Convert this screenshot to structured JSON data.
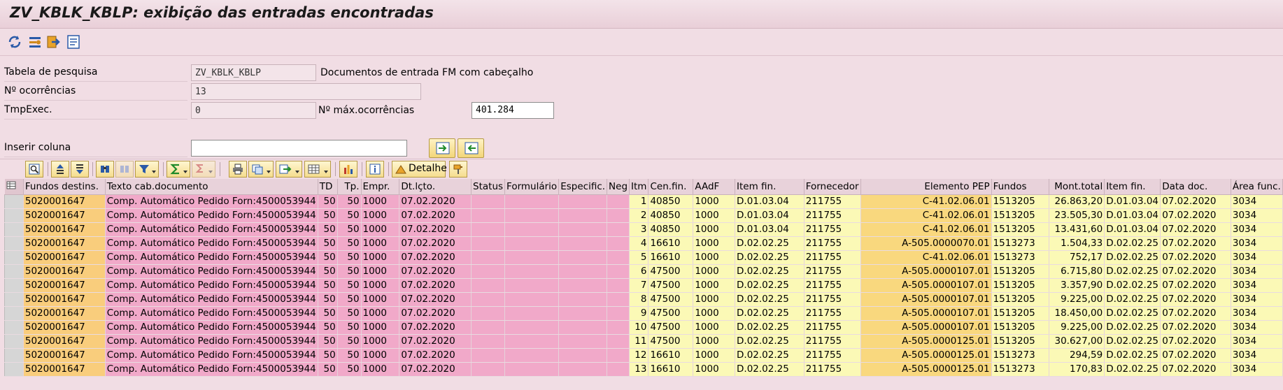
{
  "window": {
    "title": "ZV_KBLK_KBLP: exibição das entradas encontradas"
  },
  "app_toolbar": {
    "icons": [
      "refresh-icon",
      "selection-options-icon",
      "jump-icon",
      "list-icon"
    ]
  },
  "header": {
    "table_label": "Tabela de pesquisa",
    "table_value": "ZV_KBLK_KBLP",
    "table_description": "Documentos de entrada FM com cabeçalho",
    "hits_label": "Nº ocorrências",
    "hits_value": "13",
    "runtime_label": "TmpExec.",
    "runtime_value": "0",
    "max_hits_label": "Nº máx.ocorrências",
    "max_hits_value": "401.284",
    "insert_column_label": "Inserir coluna",
    "insert_column_value": ""
  },
  "grid_toolbar": {
    "detail_label": "Detalhe",
    "icons": [
      "details-icon",
      "sort-ascending-icon",
      "sort-descending-icon",
      "find-icon",
      "find-next-icon",
      "filter-icon",
      "sum-icon",
      "subtotal-icon",
      "print-icon",
      "views-icon",
      "export-icon",
      "layout-icon",
      "graphic-icon",
      "info-icon",
      "detail-icon",
      "paint-icon"
    ]
  },
  "table": {
    "columns": [
      "Fundos destins.",
      "Texto cab.documento",
      "TD",
      "Tp.",
      "Empr.",
      "Dt.lçto.",
      "Status",
      "Formulário",
      "Especific.",
      "Neg",
      "Itm",
      "Cen.fin.",
      "AAdF",
      "Item fin.",
      "Fornecedor",
      "Elemento PEP",
      "Fundos",
      "Mont.total",
      "Item fin.",
      "Data doc.",
      "Área func."
    ],
    "rows": [
      [
        "5020001647",
        "Comp. Automático Pedido Forn:4500053944",
        "50",
        "50",
        "1000",
        "07.02.2020",
        "",
        "",
        "",
        "",
        "1",
        "40850",
        "1000",
        "D.01.03.04",
        "211755",
        "C-41.02.06.01",
        "1513205",
        "26.863,20",
        "D.01.03.04",
        "07.02.2020",
        "3034"
      ],
      [
        "5020001647",
        "Comp. Automático Pedido Forn:4500053944",
        "50",
        "50",
        "1000",
        "07.02.2020",
        "",
        "",
        "",
        "",
        "2",
        "40850",
        "1000",
        "D.01.03.04",
        "211755",
        "C-41.02.06.01",
        "1513205",
        "23.505,30",
        "D.01.03.04",
        "07.02.2020",
        "3034"
      ],
      [
        "5020001647",
        "Comp. Automático Pedido Forn:4500053944",
        "50",
        "50",
        "1000",
        "07.02.2020",
        "",
        "",
        "",
        "",
        "3",
        "40850",
        "1000",
        "D.01.03.04",
        "211755",
        "C-41.02.06.01",
        "1513205",
        "13.431,60",
        "D.01.03.04",
        "07.02.2020",
        "3034"
      ],
      [
        "5020001647",
        "Comp. Automático Pedido Forn:4500053944",
        "50",
        "50",
        "1000",
        "07.02.2020",
        "",
        "",
        "",
        "",
        "4",
        "16610",
        "1000",
        "D.02.02.25",
        "211755",
        "A-505.0000070.01",
        "1513273",
        "1.504,33",
        "D.02.02.25",
        "07.02.2020",
        "3034"
      ],
      [
        "5020001647",
        "Comp. Automático Pedido Forn:4500053944",
        "50",
        "50",
        "1000",
        "07.02.2020",
        "",
        "",
        "",
        "",
        "5",
        "16610",
        "1000",
        "D.02.02.25",
        "211755",
        "C-41.02.06.01",
        "1513273",
        "752,17",
        "D.02.02.25",
        "07.02.2020",
        "3034"
      ],
      [
        "5020001647",
        "Comp. Automático Pedido Forn:4500053944",
        "50",
        "50",
        "1000",
        "07.02.2020",
        "",
        "",
        "",
        "",
        "6",
        "47500",
        "1000",
        "D.02.02.25",
        "211755",
        "A-505.0000107.01",
        "1513205",
        "6.715,80",
        "D.02.02.25",
        "07.02.2020",
        "3034"
      ],
      [
        "5020001647",
        "Comp. Automático Pedido Forn:4500053944",
        "50",
        "50",
        "1000",
        "07.02.2020",
        "",
        "",
        "",
        "",
        "7",
        "47500",
        "1000",
        "D.02.02.25",
        "211755",
        "A-505.0000107.01",
        "1513205",
        "3.357,90",
        "D.02.02.25",
        "07.02.2020",
        "3034"
      ],
      [
        "5020001647",
        "Comp. Automático Pedido Forn:4500053944",
        "50",
        "50",
        "1000",
        "07.02.2020",
        "",
        "",
        "",
        "",
        "8",
        "47500",
        "1000",
        "D.02.02.25",
        "211755",
        "A-505.0000107.01",
        "1513205",
        "9.225,00",
        "D.02.02.25",
        "07.02.2020",
        "3034"
      ],
      [
        "5020001647",
        "Comp. Automático Pedido Forn:4500053944",
        "50",
        "50",
        "1000",
        "07.02.2020",
        "",
        "",
        "",
        "",
        "9",
        "47500",
        "1000",
        "D.02.02.25",
        "211755",
        "A-505.0000107.01",
        "1513205",
        "18.450,00",
        "D.02.02.25",
        "07.02.2020",
        "3034"
      ],
      [
        "5020001647",
        "Comp. Automático Pedido Forn:4500053944",
        "50",
        "50",
        "1000",
        "07.02.2020",
        "",
        "",
        "",
        "",
        "10",
        "47500",
        "1000",
        "D.02.02.25",
        "211755",
        "A-505.0000107.01",
        "1513205",
        "9.225,00",
        "D.02.02.25",
        "07.02.2020",
        "3034"
      ],
      [
        "5020001647",
        "Comp. Automático Pedido Forn:4500053944",
        "50",
        "50",
        "1000",
        "07.02.2020",
        "",
        "",
        "",
        "",
        "11",
        "47500",
        "1000",
        "D.02.02.25",
        "211755",
        "A-505.0000125.01",
        "1513205",
        "30.627,00",
        "D.02.02.25",
        "07.02.2020",
        "3034"
      ],
      [
        "5020001647",
        "Comp. Automático Pedido Forn:4500053944",
        "50",
        "50",
        "1000",
        "07.02.2020",
        "",
        "",
        "",
        "",
        "12",
        "16610",
        "1000",
        "D.02.02.25",
        "211755",
        "A-505.0000125.01",
        "1513273",
        "294,59",
        "D.02.02.25",
        "07.02.2020",
        "3034"
      ],
      [
        "5020001647",
        "Comp. Automático Pedido Forn:4500053944",
        "50",
        "50",
        "1000",
        "07.02.2020",
        "",
        "",
        "",
        "",
        "13",
        "16610",
        "1000",
        "D.02.02.25",
        "211755",
        "A-505.0000125.01",
        "1513273",
        "170,83",
        "D.02.02.25",
        "07.02.2020",
        "3034"
      ]
    ]
  },
  "colors": {
    "background": "#f1dde4",
    "key_column": "#f9cd7c",
    "header_fields": "#f1a9c9",
    "item_fields": "#fbf9b6",
    "pep_column": "#f9d87e"
  }
}
